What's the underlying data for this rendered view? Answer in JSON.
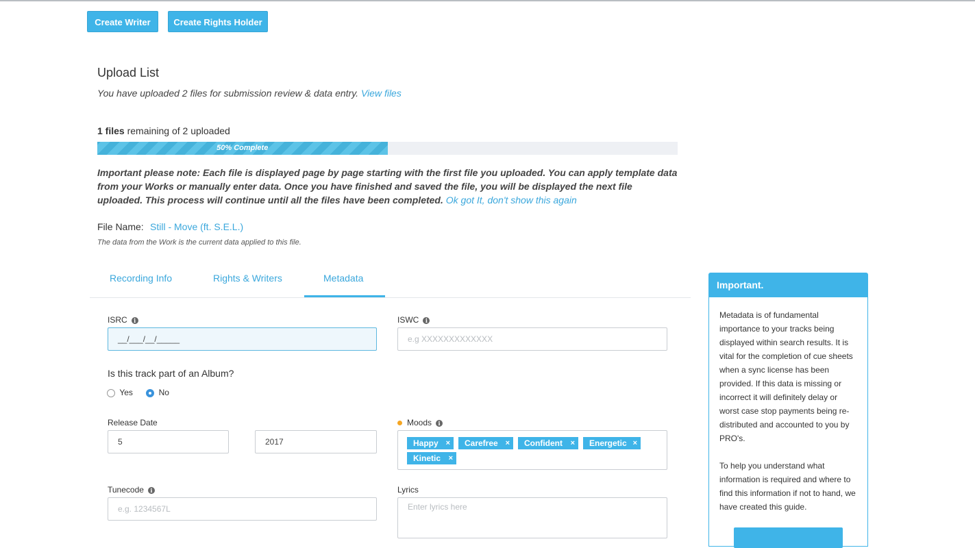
{
  "toolbar": {
    "create_writer": "Create Writer",
    "create_rights_holder": "Create Rights Holder"
  },
  "upload": {
    "title": "Upload List",
    "subtitle": "You have uploaded 2 files for submission review & data entry.",
    "view_files": "View files",
    "remaining_count": "1 files",
    "remaining_rest": " remaining of 2 uploaded",
    "progress_percent": 50,
    "progress_label": "50% Complete",
    "note": "Important please note: Each file is displayed page by page starting with the first file you uploaded. You can apply template data from your Works or manually enter data. Once you have finished and saved the file, you will be displayed the next file uploaded. This process will continue until all the files have been completed.",
    "note_link": "Ok got It, don't show this again"
  },
  "file": {
    "label": "File Name:",
    "name": "Still - Move (ft. S.E.L.)",
    "note": "The data from the Work is the current data applied to this file."
  },
  "tabs": [
    {
      "label": "Recording Info"
    },
    {
      "label": "Rights & Writers"
    },
    {
      "label": "Metadata",
      "active": true
    }
  ],
  "form": {
    "isrc_label": "ISRC",
    "isrc_value": "__/___/__/_____",
    "iswc_label": "ISWC",
    "iswc_placeholder": "e.g  XXXXXXXXXXXXX",
    "album_question": "Is this track part of an Album?",
    "album_yes": "Yes",
    "album_no": "No",
    "album_selected": "No",
    "release_date_label": "Release Date",
    "release_month": "5",
    "release_year": "2017",
    "moods_label": "Moods",
    "moods": [
      "Happy",
      "Carefree",
      "Confident",
      "Energetic",
      "Kinetic"
    ],
    "tunecode_label": "Tunecode",
    "tunecode_placeholder": "e.g. 1234567L",
    "lyrics_label": "Lyrics",
    "lyrics_placeholder": "Enter lyrics here"
  },
  "panel": {
    "title": "Important.",
    "para1": "Metadata is of fundamental importance to your tracks being displayed within search results. It is vital for the completion of cue sheets when a sync license has been provided. If this data is missing or incorrect it will definitely delay or worst case stop payments being re-distributed and accounted to you by PRO's.",
    "para2": "To help you understand what information is required and where to find this information if not to hand, we have created this guide."
  },
  "colors": {
    "accent": "#3fb4e8",
    "link": "#3aa7dc",
    "mood_dot": "#f5a623"
  }
}
